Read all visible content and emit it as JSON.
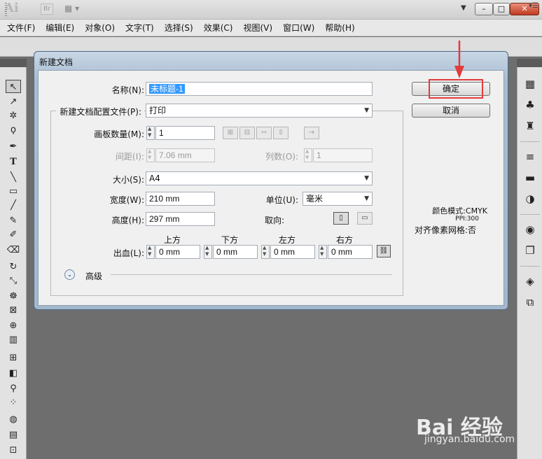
{
  "app": {
    "logo": "Ai",
    "bridge_label": "Br"
  },
  "window_controls": {
    "min": "–",
    "max": "□",
    "close": "✕"
  },
  "menu": [
    "文件(F)",
    "编辑(E)",
    "对象(O)",
    "文字(T)",
    "选择(S)",
    "效果(C)",
    "视图(V)",
    "窗口(W)",
    "帮助(H)"
  ],
  "dialog": {
    "title": "新建文档",
    "name_label": "名称(N):",
    "name_value": "未标题-1",
    "profile_label": "新建文档配置文件(P):",
    "profile_value": "打印",
    "artboards_label": "画板数量(M):",
    "artboards_value": "1",
    "spacing_label": "间距(I):",
    "spacing_value": "7.06 mm",
    "columns_label": "列数(O):",
    "columns_value": "1",
    "size_label": "大小(S):",
    "size_value": "A4",
    "width_label": "宽度(W):",
    "width_value": "210 mm",
    "units_label": "单位(U):",
    "units_value": "毫米",
    "height_label": "高度(H):",
    "height_value": "297 mm",
    "orientation_label": "取向:",
    "bleed_label": "出血(L):",
    "bleed_top_label": "上方",
    "bleed_bottom_label": "下方",
    "bleed_left_label": "左方",
    "bleed_right_label": "右方",
    "bleed_top": "0 mm",
    "bleed_bottom": "0 mm",
    "bleed_left": "0 mm",
    "bleed_right": "0 mm",
    "advanced_label": "高级",
    "ok_label": "确定",
    "cancel_label": "取消",
    "color_mode": "颜色模式:CMYK",
    "ppi": "PPI:300",
    "pixel_grid": "对齐像素网格:否"
  },
  "watermark": {
    "logo": "Bai 经验",
    "url": "jingyan.baidu.com"
  },
  "colors": {
    "highlight_box": "#e23b3b",
    "selection": "#3399ff"
  }
}
